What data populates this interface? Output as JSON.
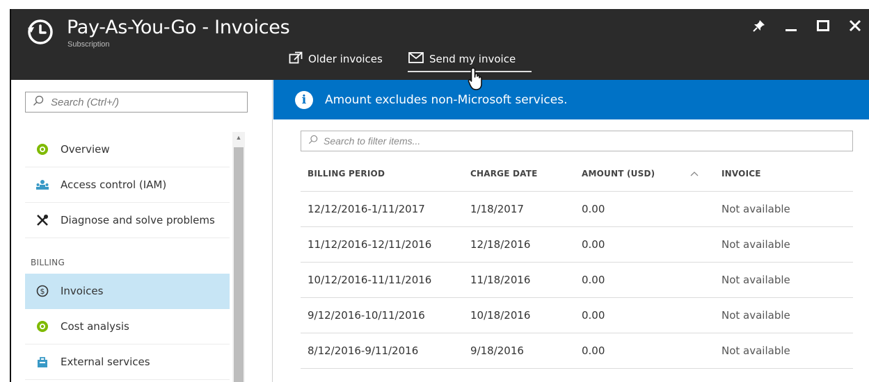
{
  "window": {
    "title": "Pay-As-You-Go - Invoices",
    "subtitle": "Subscription"
  },
  "toolbar": {
    "older_invoices": "Older invoices",
    "send_invoice": "Send my invoice"
  },
  "sidebar": {
    "search_placeholder": "Search (Ctrl+/)",
    "items": [
      {
        "label": "Overview",
        "icon": "overview-icon"
      },
      {
        "label": "Access control (IAM)",
        "icon": "people-icon"
      },
      {
        "label": "Diagnose and solve problems",
        "icon": "wrench-icon"
      }
    ],
    "billing_section": "BILLING",
    "billing_items": [
      {
        "label": "Invoices",
        "icon": "dollar-icon",
        "active": true
      },
      {
        "label": "Cost analysis",
        "icon": "cost-icon"
      },
      {
        "label": "External services",
        "icon": "bag-icon"
      }
    ]
  },
  "main": {
    "banner": "Amount excludes non-Microsoft services.",
    "filter_placeholder": "Search to filter items...",
    "columns": [
      "BILLING PERIOD",
      "CHARGE DATE",
      "AMOUNT (USD)",
      "INVOICE"
    ],
    "rows": [
      {
        "period": "12/12/2016-1/11/2017",
        "charge_date": "1/18/2017",
        "amount": "0.00",
        "invoice": "Not available"
      },
      {
        "period": "11/12/2016-12/11/2016",
        "charge_date": "12/18/2016",
        "amount": "0.00",
        "invoice": "Not available"
      },
      {
        "period": "10/12/2016-11/11/2016",
        "charge_date": "11/18/2016",
        "amount": "0.00",
        "invoice": "Not available"
      },
      {
        "period": "9/12/2016-10/11/2016",
        "charge_date": "10/18/2016",
        "amount": "0.00",
        "invoice": "Not available"
      },
      {
        "period": "8/12/2016-9/11/2016",
        "charge_date": "9/18/2016",
        "amount": "0.00",
        "invoice": "Not available"
      }
    ]
  },
  "colors": {
    "header_bg": "#2b2b2b",
    "banner_bg": "#0072c6",
    "active_item_bg": "#c7e5f5",
    "overview_icon": "#7fba00",
    "access_icon": "#3999c6"
  }
}
